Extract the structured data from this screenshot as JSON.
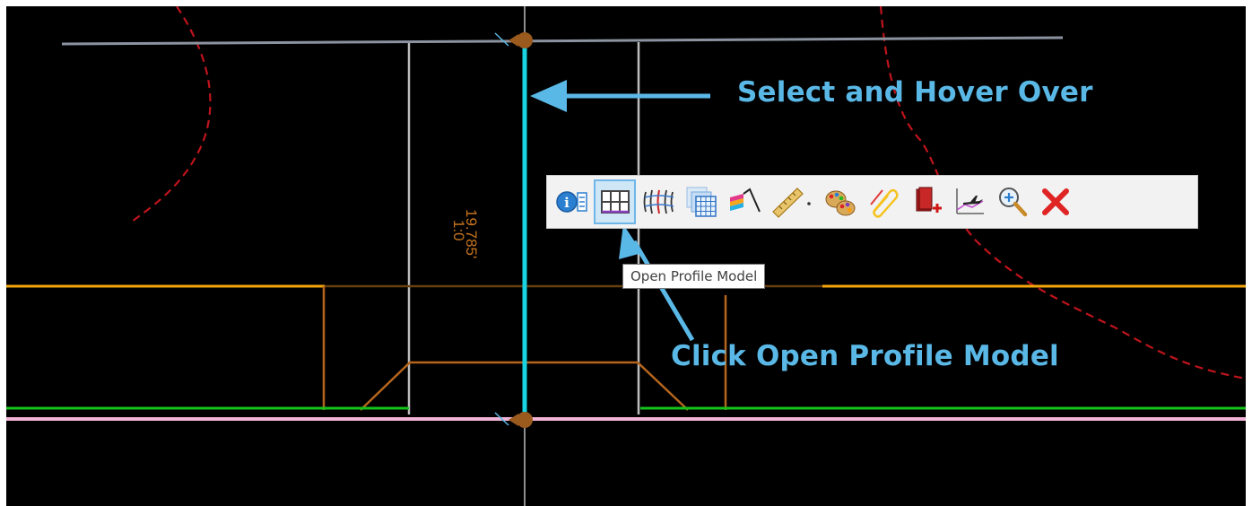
{
  "callouts": {
    "select_hover": "Select and Hover Over",
    "click_profile": "Click Open Profile Model"
  },
  "drawing": {
    "dimension_text": "19.785'",
    "scale_text": "1:0"
  },
  "toolbar": {
    "buttons": [
      {
        "name": "properties",
        "icon": "info-list-icon"
      },
      {
        "name": "open-profile-model",
        "icon": "profile-grid-icon",
        "active": true
      },
      {
        "name": "3d-model",
        "icon": "3d-mesh-icon"
      },
      {
        "name": "cross-section",
        "icon": "grid-stack-icon"
      },
      {
        "name": "surface-template",
        "icon": "template-ribbon-icon"
      },
      {
        "name": "measure",
        "icon": "ruler-icon"
      },
      {
        "name": "material",
        "icon": "palette-icon"
      },
      {
        "name": "attach",
        "icon": "paperclip-icon"
      },
      {
        "name": "add-component",
        "icon": "book-plus-icon"
      },
      {
        "name": "view-profile",
        "icon": "chart-plane-icon"
      },
      {
        "name": "zoom",
        "icon": "magnifier-icon"
      },
      {
        "name": "close",
        "icon": "close-icon"
      }
    ]
  },
  "tooltip": {
    "text": "Open Profile Model"
  },
  "colors": {
    "background": "#000000",
    "callout": "#5ab8e6",
    "selected_line": "#19d3e0",
    "orange_line": "#f2a60d",
    "green_line": "#13c51b",
    "pink_line": "#f0b3d6",
    "brown_line": "#b5651d",
    "red_dashed": "#c0141c"
  }
}
